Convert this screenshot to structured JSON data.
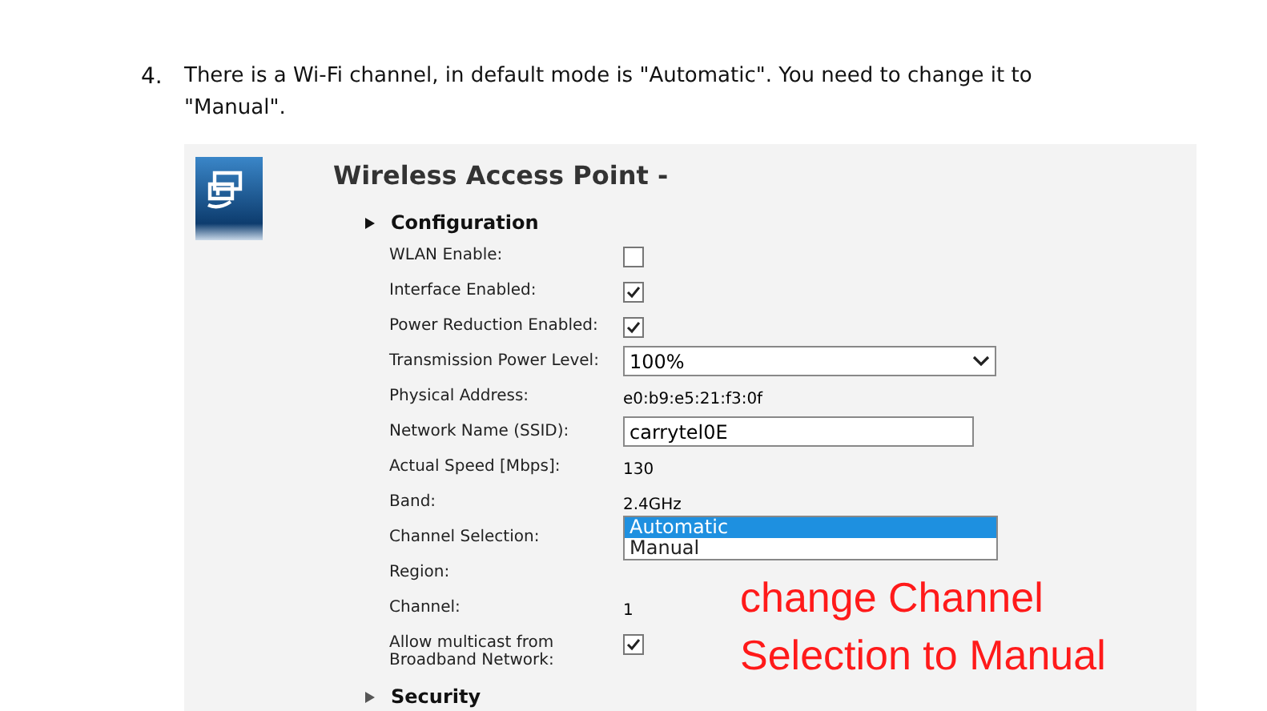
{
  "instruction": {
    "number": "4.",
    "text": "There is a Wi-Fi channel, in default mode is \"Automatic\". You need to change it to \"Manual\"."
  },
  "panel": {
    "title": "Wireless Access Point -",
    "sections": [
      {
        "title": "Configuration",
        "expanded": true,
        "rows": [
          {
            "kind": "checkbox",
            "label": "WLAN Enable:",
            "checked": false
          },
          {
            "kind": "checkbox",
            "label": "Interface Enabled:",
            "checked": true
          },
          {
            "kind": "checkbox",
            "label": "Power Reduction Enabled:",
            "checked": true
          },
          {
            "kind": "select",
            "label": "Transmission Power Level:",
            "value": "100%"
          },
          {
            "kind": "text",
            "label": "Physical Address:",
            "value": "e0:b9:e5:21:f3:0f"
          },
          {
            "kind": "input",
            "label": "Network Name (SSID):",
            "value": "carrytel0E"
          },
          {
            "kind": "text",
            "label": "Actual Speed [Mbps]:",
            "value": "130"
          },
          {
            "kind": "text",
            "label": "Band:",
            "value": "2.4GHz"
          },
          {
            "kind": "listbox",
            "label": "Channel Selection:",
            "options": [
              {
                "label": "Automatic",
                "selected": true
              },
              {
                "label": "Manual",
                "selected": false
              }
            ]
          },
          {
            "kind": "text",
            "label": "Region:"
          },
          {
            "kind": "text",
            "label": "Channel:",
            "value": "1"
          },
          {
            "kind": "checkbox",
            "label": "Allow multicast from Broadband Network:",
            "checked": true
          }
        ]
      },
      {
        "title": "Security",
        "expanded": false
      }
    ]
  },
  "annotation": [
    "change Channel",
    "Selection to Manual"
  ]
}
